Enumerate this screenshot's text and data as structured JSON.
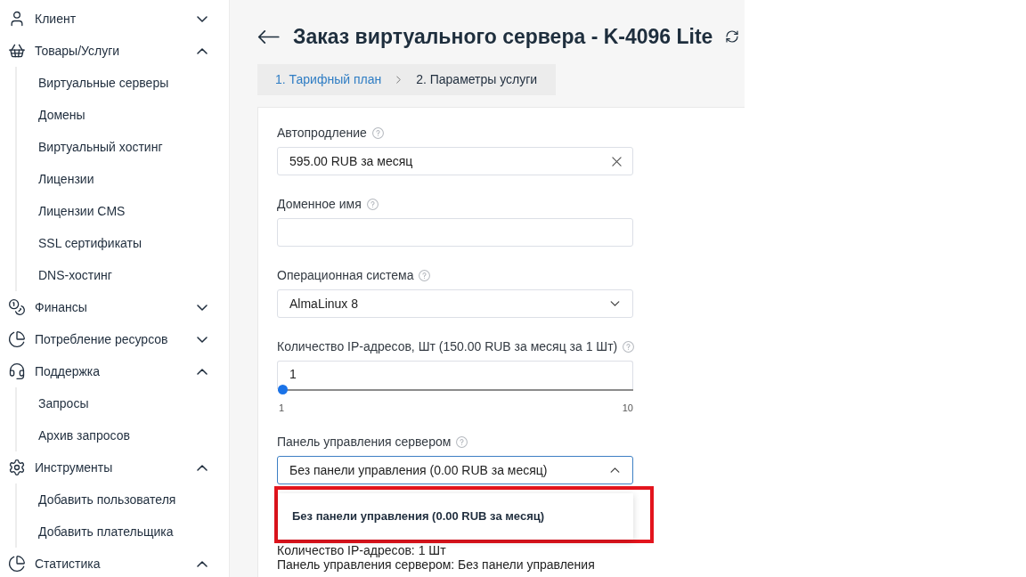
{
  "sidebar": {
    "items": [
      {
        "label": "Клиент",
        "expanded": false
      },
      {
        "label": "Товары/Услуги",
        "expanded": true,
        "children": [
          {
            "label": "Виртуальные серверы"
          },
          {
            "label": "Домены"
          },
          {
            "label": "Виртуальный хостинг"
          },
          {
            "label": "Лицензии"
          },
          {
            "label": "Лицензии CMS"
          },
          {
            "label": "SSL сертификаты"
          },
          {
            "label": "DNS-хостинг"
          }
        ]
      },
      {
        "label": "Финансы",
        "expanded": false
      },
      {
        "label": "Потребление ресурсов",
        "expanded": false
      },
      {
        "label": "Поддержка",
        "expanded": true,
        "children": [
          {
            "label": "Запросы"
          },
          {
            "label": "Архив запросов"
          }
        ]
      },
      {
        "label": "Инструменты",
        "expanded": true,
        "children": [
          {
            "label": "Добавить пользователя"
          },
          {
            "label": "Добавить плательщика"
          }
        ]
      },
      {
        "label": "Статистика",
        "expanded": true
      }
    ]
  },
  "header": {
    "title": "Заказ виртуального сервера - K-4096 Lite"
  },
  "steps": [
    {
      "label": "1. Тарифный план",
      "selected": false
    },
    {
      "label": "2. Параметры услуги",
      "selected": true
    }
  ],
  "form": {
    "fields": [
      {
        "kind": "text",
        "label": "Автопродление",
        "value": "595.00 RUB за месяц",
        "clearable": true
      },
      {
        "kind": "text",
        "label": "Доменное имя"
      },
      {
        "kind": "select",
        "label": "Операционная система",
        "value": "AlmaLinux 8",
        "expanded": false
      },
      {
        "kind": "slider",
        "label": "Количество IP-адресов, Шт (150.00 RUB за месяц за 1 Шт)",
        "value": "1",
        "level": 0,
        "min_label": "1",
        "max_label": "10"
      },
      {
        "kind": "select",
        "label": "Панель управления сервером",
        "value": "Без панели управления (0.00 RUB за месяц)",
        "expanded": true,
        "options": [
          {
            "label": "Без панели управления (0.00 RUB за месяц)",
            "selected": true
          }
        ]
      }
    ],
    "summary": [
      "Количество IP-адресов: 1 Шт",
      "Панель управления сервером: Без панели управления"
    ]
  }
}
